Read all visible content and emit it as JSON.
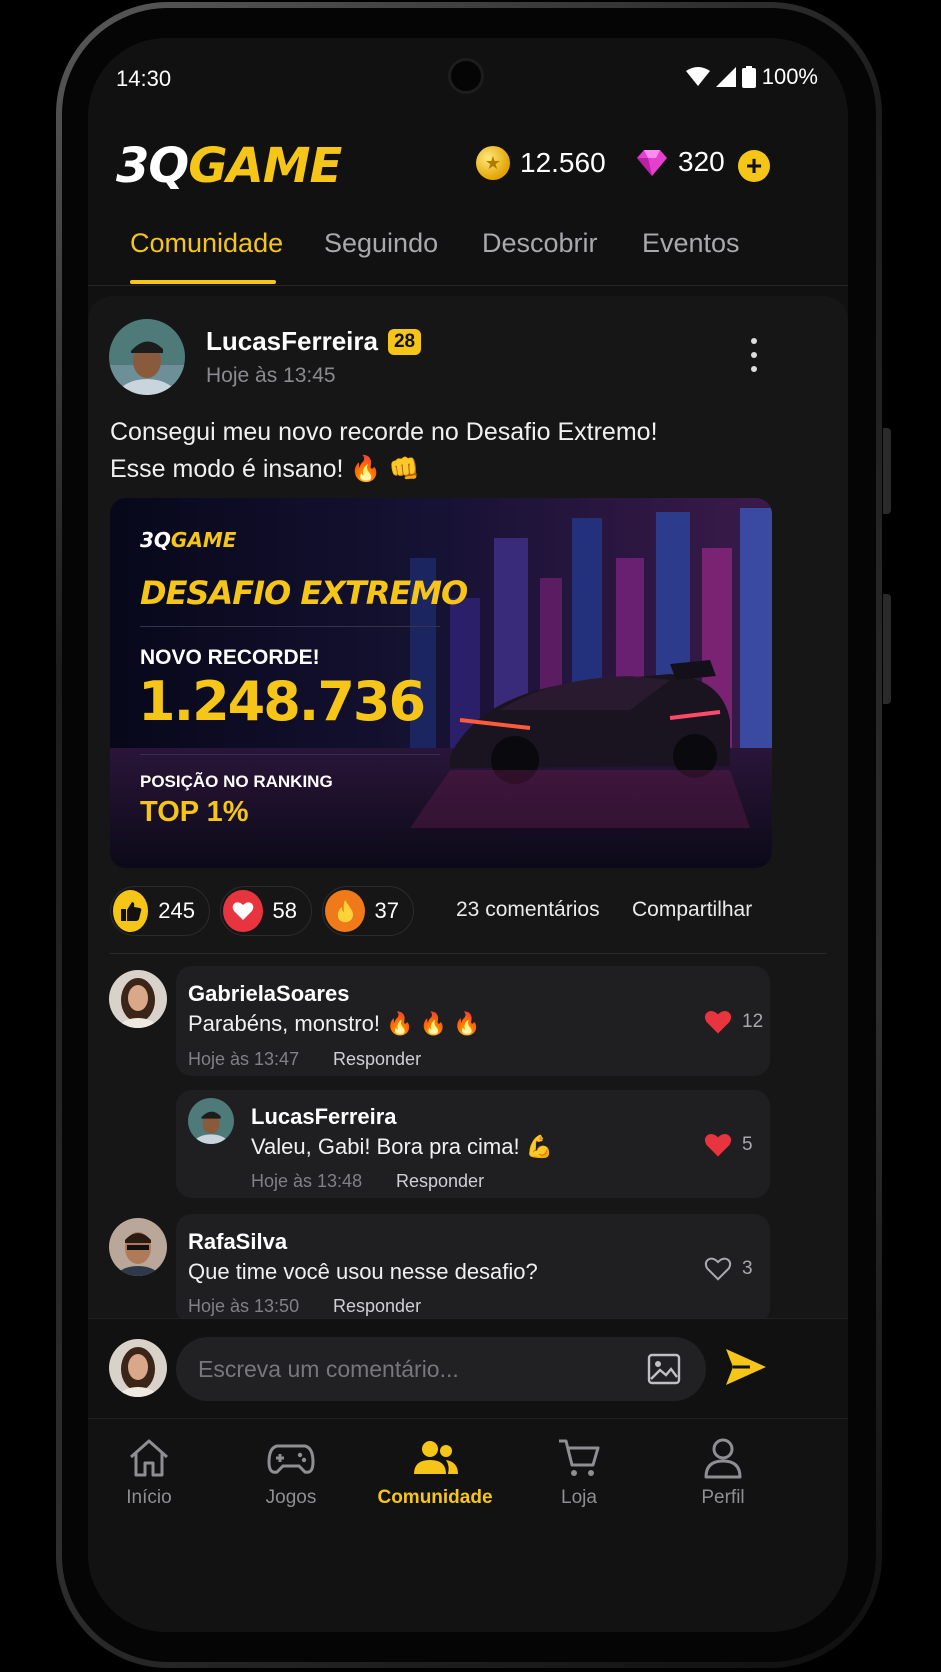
{
  "status_bar": {
    "time": "14:30",
    "battery": "100%"
  },
  "header": {
    "logo_white": "3Q",
    "logo_yellow": "GAME",
    "coins": "12.560",
    "gems": "320",
    "coin_icon": "coin-icon",
    "gem_icon": "gem-icon",
    "add_icon": "plus-icon"
  },
  "tabs": [
    {
      "label": "Comunidade",
      "active": true
    },
    {
      "label": "Seguindo",
      "active": false
    },
    {
      "label": "Descobrir",
      "active": false
    },
    {
      "label": "Eventos",
      "active": false
    }
  ],
  "post": {
    "username": "LucasFerreira",
    "level": "28",
    "time": "Hoje às 13:45",
    "text_line1": "Consegui meu novo recorde no Desafio Extremo!",
    "text_line2": "Esse modo é insano! 🔥 👊",
    "banner": {
      "logo_white": "3Q",
      "logo_yellow": "GAME",
      "title": "DESAFIO EXTREMO",
      "new_record": "NOVO RECORDE!",
      "score": "1.248.736",
      "ranking_label": "POSIÇÃO NO RANKING",
      "ranking_value": "TOP 1%"
    },
    "reactions": [
      {
        "icon": "thumbs-up-icon",
        "count": "245",
        "color": "#f5c518"
      },
      {
        "icon": "heart-icon",
        "count": "58",
        "color": "#e8343f"
      },
      {
        "icon": "fire-icon",
        "count": "37",
        "color": "#f07a1a"
      }
    ],
    "comments_label": "23 comentários",
    "share_label": "Compartilhar"
  },
  "comments": [
    {
      "name": "GabrielaSoares",
      "text": "Parabéns, monstro! 🔥 🔥 🔥",
      "time": "Hoje às 13:47",
      "reply": "Responder",
      "likes": "12",
      "liked": true
    },
    {
      "name": "LucasFerreira",
      "text": "Valeu, Gabi! Bora pra cima! 💪",
      "time": "Hoje às 13:48",
      "reply": "Responder",
      "likes": "5",
      "liked": true
    },
    {
      "name": "RafaSilva",
      "text": "Que time você usou nesse desafio?",
      "time": "Hoje às 13:50",
      "reply": "Responder",
      "likes": "3",
      "liked": false
    }
  ],
  "composer": {
    "placeholder": "Escreva um comentário..."
  },
  "bottom_nav": [
    {
      "label": "Início",
      "icon": "home-icon",
      "active": false
    },
    {
      "label": "Jogos",
      "icon": "gamepad-icon",
      "active": false
    },
    {
      "label": "Comunidade",
      "icon": "community-icon",
      "active": true
    },
    {
      "label": "Loja",
      "icon": "cart-icon",
      "active": false
    },
    {
      "label": "Perfil",
      "icon": "profile-icon",
      "active": false
    }
  ],
  "colors": {
    "accent": "#f5c518",
    "background": "#111112",
    "card": "#161617",
    "like_red": "#e8343f"
  }
}
